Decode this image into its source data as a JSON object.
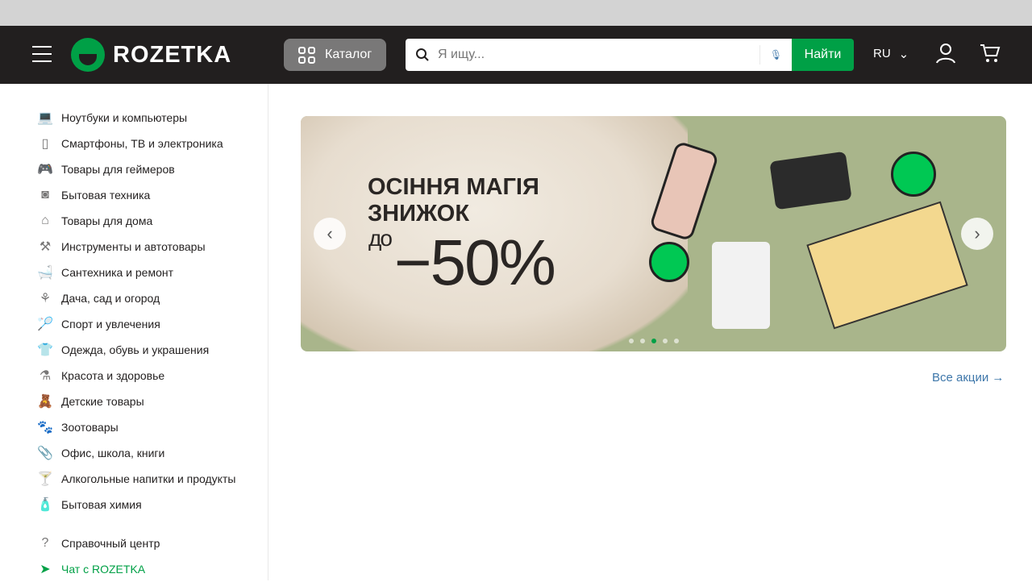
{
  "header": {
    "logo_text": "ROZETKA",
    "catalog_label": "Каталог",
    "search_placeholder": "Я ищу...",
    "search_button": "Найти",
    "language": "RU"
  },
  "sidebar": {
    "categories": [
      {
        "label": "Ноутбуки и компьютеры",
        "icon": "laptop-icon",
        "glyph": "💻"
      },
      {
        "label": "Смартфоны, ТВ и электроника",
        "icon": "smartphone-icon",
        "glyph": "▯"
      },
      {
        "label": "Товары для геймеров",
        "icon": "gamepad-icon",
        "glyph": "🎮"
      },
      {
        "label": "Бытовая техника",
        "icon": "washing-machine-icon",
        "glyph": "◙"
      },
      {
        "label": "Товары для дома",
        "icon": "armchair-icon",
        "glyph": "⌂"
      },
      {
        "label": "Инструменты и автотовары",
        "icon": "drill-icon",
        "glyph": "⚒"
      },
      {
        "label": "Сантехника и ремонт",
        "icon": "bathtub-icon",
        "glyph": "🛁"
      },
      {
        "label": "Дача, сад и огород",
        "icon": "garden-tools-icon",
        "glyph": "⚘"
      },
      {
        "label": "Спорт и увлечения",
        "icon": "racket-icon",
        "glyph": "🏸"
      },
      {
        "label": "Одежда, обувь и украшения",
        "icon": "tshirt-icon",
        "glyph": "👕"
      },
      {
        "label": "Красота и здоровье",
        "icon": "cosmetics-icon",
        "glyph": "⚗"
      },
      {
        "label": "Детские товары",
        "icon": "teddy-bear-icon",
        "glyph": "🧸"
      },
      {
        "label": "Зоотовары",
        "icon": "paw-icon",
        "glyph": "🐾"
      },
      {
        "label": "Офис, школа, книги",
        "icon": "paperclip-icon",
        "glyph": "📎"
      },
      {
        "label": "Алкогольные напитки и продукты",
        "icon": "cocktail-icon",
        "glyph": "🍸"
      },
      {
        "label": "Бытовая химия",
        "icon": "spray-bottle-icon",
        "glyph": "🧴"
      }
    ],
    "help": {
      "label": "Справочный центр",
      "glyph": "?"
    },
    "chat": {
      "label": "Чат с ROZETKA",
      "glyph": "➤"
    }
  },
  "banner": {
    "line1": "ОСІННЯ МАГІЯ",
    "line2": "ЗНИЖОК",
    "prefix": "до",
    "discount": "−50%",
    "slides": 5,
    "active_slide": 3
  },
  "main": {
    "all_promos": "Все акции →"
  },
  "colors": {
    "header": "#221f1f",
    "brand_green": "#00a046",
    "link": "#3e77aa"
  }
}
